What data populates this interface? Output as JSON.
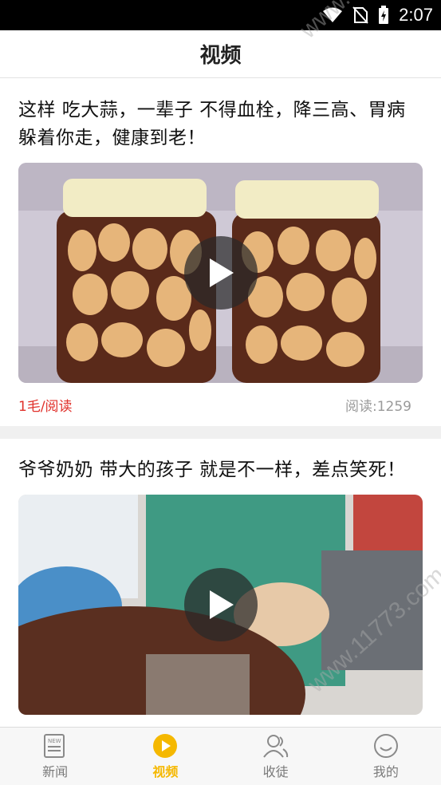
{
  "status_bar": {
    "time": "2:07"
  },
  "header": {
    "title": "视频"
  },
  "feed": [
    {
      "title": "这样 吃大蒜，一辈子 不得血栓，降三高、胃病躲着你走，健康到老！",
      "reward": "1毛/阅读",
      "reads": "阅读:1259"
    },
    {
      "title": "爷爷奶奶 带大的孩子 就是不一样，差点笑死！"
    }
  ],
  "tabs": [
    {
      "label": "新闻",
      "icon": "news-icon",
      "active": false
    },
    {
      "label": "视频",
      "icon": "video-play-icon",
      "active": true
    },
    {
      "label": "收徒",
      "icon": "apprentice-icon",
      "active": false
    },
    {
      "label": "我的",
      "icon": "profile-smile-icon",
      "active": false
    }
  ],
  "watermark": "www.11773.com",
  "colors": {
    "accent": "#f5b800",
    "reward": "#e0302a",
    "muted": "#9a9a9a"
  }
}
